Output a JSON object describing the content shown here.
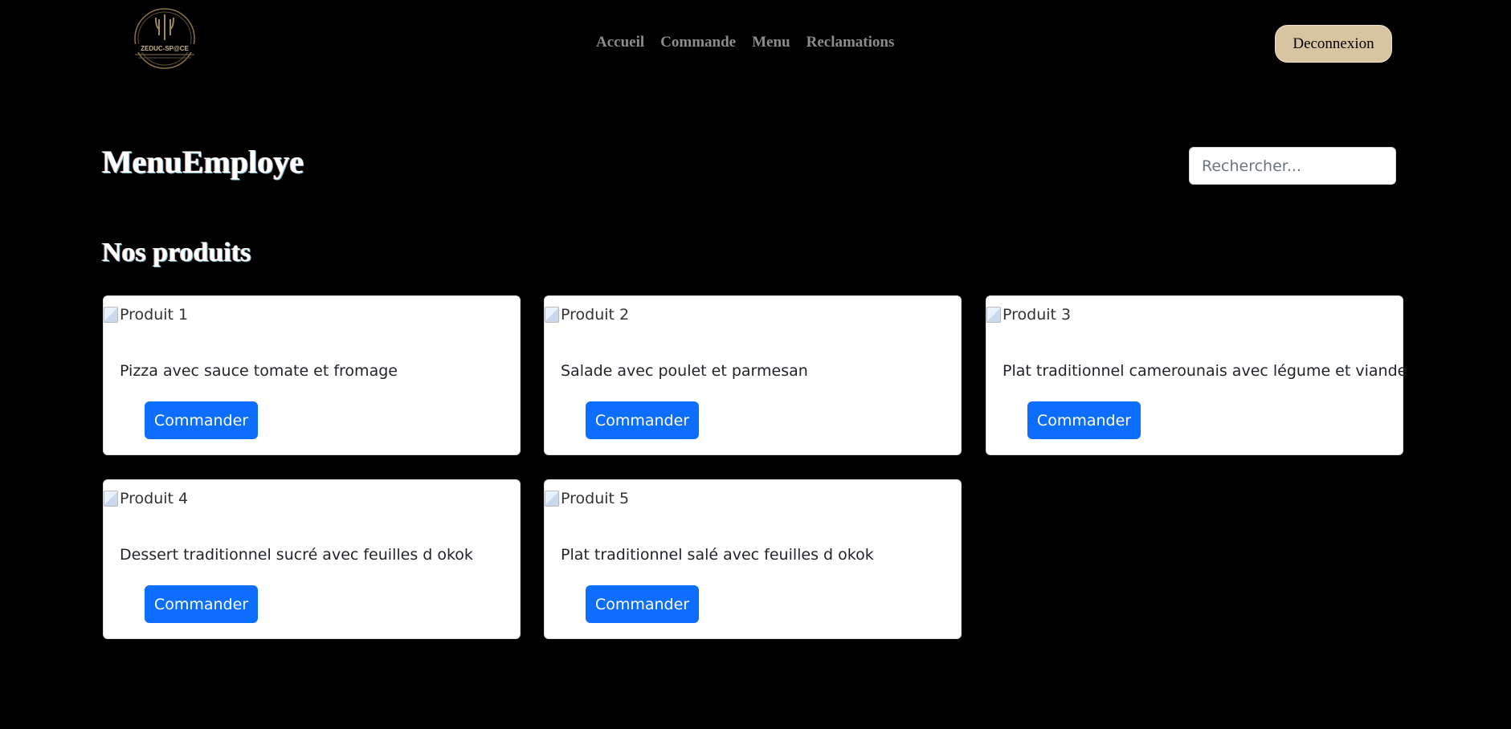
{
  "header": {
    "logo_alt": "ZEDUC-SP@CE",
    "nav": [
      "Accueil",
      "Commande",
      "Menu",
      "Reclamations"
    ],
    "logout_label": "Deconnexion"
  },
  "page_title": "MenuEmploye",
  "search": {
    "placeholder": "Rechercher..."
  },
  "section_title": "Nos produits",
  "products": [
    {
      "alt": "Produit 1",
      "description": "Pizza avec sauce tomate et fromage",
      "button": "Commander"
    },
    {
      "alt": "Produit 2",
      "description": "Salade avec poulet et parmesan",
      "button": "Commander"
    },
    {
      "alt": "Produit 3",
      "description": "Plat traditionnel camerounais avec légume et viande",
      "button": "Commander"
    },
    {
      "alt": "Produit 4",
      "description": "Dessert traditionnel sucré avec feuilles d okok",
      "button": "Commander"
    },
    {
      "alt": "Produit 5",
      "description": "Plat traditionnel salé avec feuilles d okok",
      "button": "Commander"
    }
  ],
  "colors": {
    "background": "#000000",
    "accent_button": "#0d6efd",
    "logout_bg": "#d8c4a0"
  }
}
